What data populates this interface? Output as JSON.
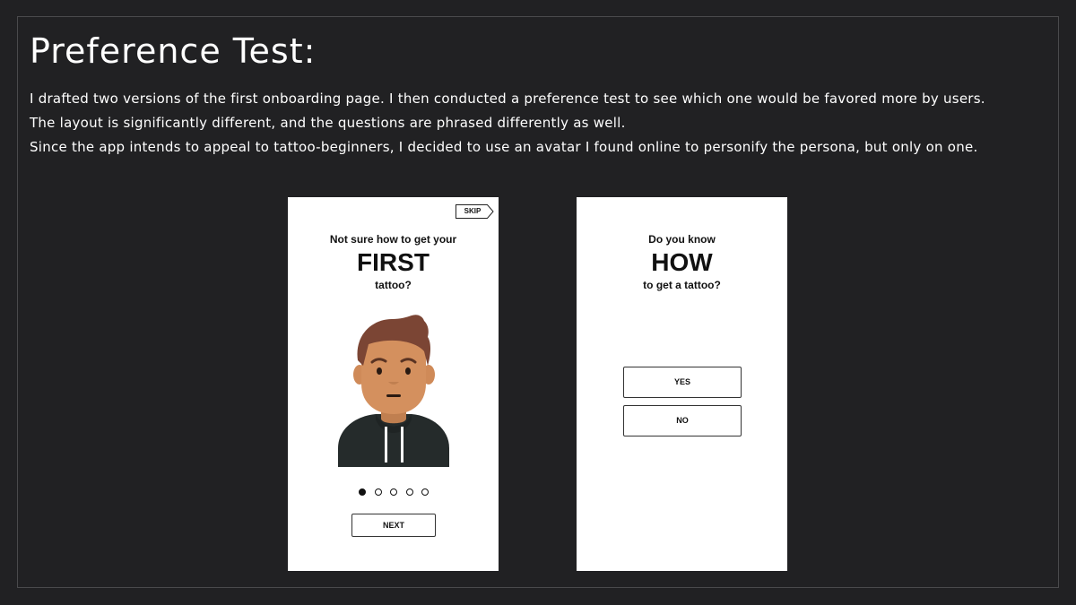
{
  "page": {
    "title": "Preference Test:",
    "description": [
      "I drafted two versions of the first onboarding page. I then conducted a preference test to see which one would be favored more by users.",
      "The layout is significantly different, and the questions are phrased differently as well.",
      "Since the app intends to appeal to tattoo-beginners, I decided to use an avatar I found online to personify the persona, but only on one."
    ]
  },
  "version_a": {
    "skip_label": "SKIP",
    "question_pre": "Not sure how to get your",
    "question_emphasis": "FIRST",
    "question_post": "tattoo?",
    "avatar_icon": "persona-avatar-icon",
    "pagination": {
      "total": 5,
      "current": 1
    },
    "next_label": "NEXT"
  },
  "version_b": {
    "question_pre": "Do you know",
    "question_emphasis": "HOW",
    "question_post": "to get a tattoo?",
    "yes_label": "YES",
    "no_label": "NO"
  },
  "colors": {
    "background": "#212123",
    "frame_border": "#4a4a4c",
    "card": "#ffffff",
    "text_dark": "#111111",
    "avatar_hair": "#7b4534",
    "avatar_skin": "#d4905e",
    "avatar_hoodie": "#252b2b"
  }
}
